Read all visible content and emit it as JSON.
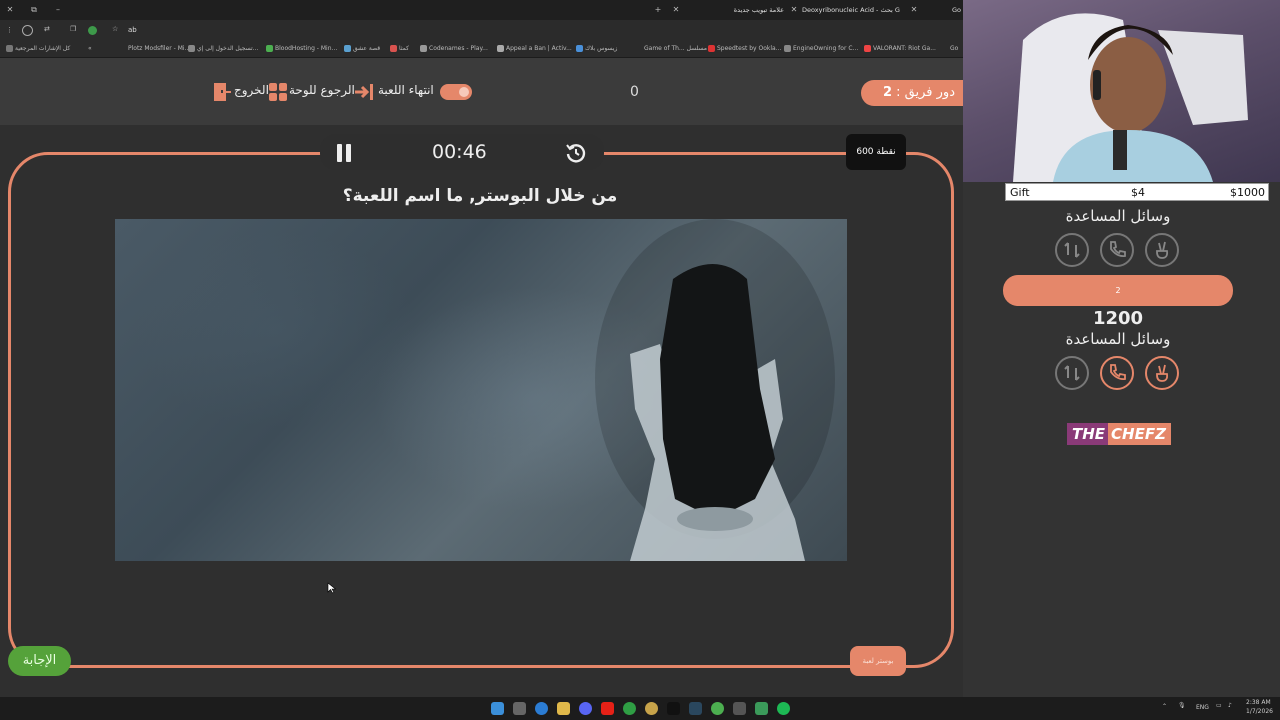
{
  "browser": {
    "tabs": [
      {
        "label": "علامة تبويب جديدة"
      },
      {
        "label": "Deoxyribonucleic Acid - بحث G"
      },
      {
        "label": "Go"
      }
    ],
    "address": "ab",
    "bookmarks": [
      "كل الإشارات المرجعية",
      "Plotz Modsfiler - Mi...",
      "تسجيل الدخول إلى إي...",
      "BloodHosting - Min...",
      "قصة عشق",
      "كمثا",
      "Codenames - Play...",
      "Appeal a Ban | Activ...",
      "زيسوس بلاك",
      "Game of Th... مسلسل",
      "Speedtest by Ookla...",
      "EngineOwning for C...",
      "VALORANT: Riot Ga...",
      "Go"
    ]
  },
  "game": {
    "turn_label": "دور فريق :",
    "turn_number": "2",
    "score": "0",
    "end_game": "انتهاء اللعبة",
    "back_to_board": "الرجوع للوحة",
    "exit": "الخروج",
    "timer": "00:46",
    "points": "600 نقطة",
    "question": "من خلال البوستر, ما اسم اللعبة؟",
    "answer_button": "الإجابة",
    "poster_button": "بوستر لعبة"
  },
  "stream": {
    "gift_label": "Gift",
    "gift_amount": "$4",
    "gift_goal": "$1000"
  },
  "teams": [
    {
      "help_label": "وسائل المساعدة"
    },
    {
      "name": "2",
      "score": "1200",
      "help_label": "وسائل المساعدة"
    }
  ],
  "logo": {
    "part1": "THE",
    "part2": "CHEFZ"
  },
  "taskbar": {
    "lang": "ENG",
    "time": "2:38 AM",
    "date": "1/7/2026"
  },
  "colors": {
    "accent": "#e5876a",
    "answer_green": "#55a23a",
    "background": "#2f2f2f"
  }
}
